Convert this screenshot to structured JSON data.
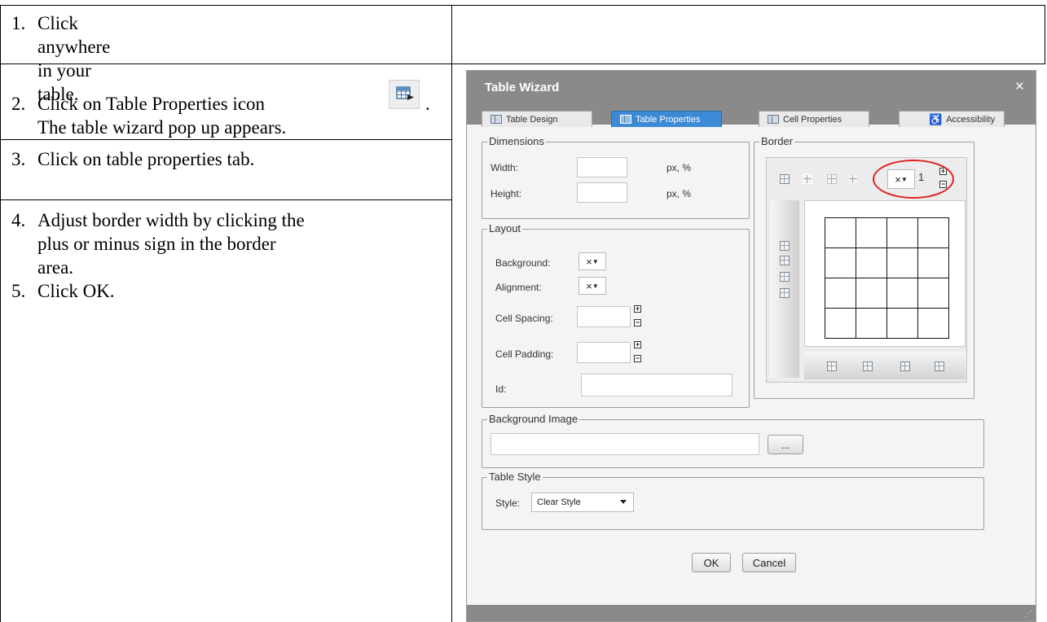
{
  "steps": [
    {
      "num": "1.",
      "lines": [
        "Click anywhere in your table."
      ]
    },
    {
      "num": "2.",
      "lines": [
        "Click on Table Properties icon",
        "The table wizard pop up appears."
      ]
    },
    {
      "num": "3.",
      "lines": [
        "Click on table properties tab."
      ]
    },
    {
      "num": "4.",
      "lines": [
        "Adjust border width by clicking the",
        "plus or minus sign in the border",
        "area."
      ]
    },
    {
      "num": "5.",
      "lines": [
        "Click OK."
      ]
    }
  ],
  "icons": {
    "table_properties": "table-properties-icon",
    "close": "close-icon",
    "plus": "plus-icon",
    "minus": "minus-icon",
    "no_color": "no-color-x-icon",
    "dropdown": "chevron-down-icon",
    "resize": "resize-grip-icon"
  },
  "colors": {
    "title_bar": "#8a8a8a",
    "active_tab": "#3c8ad6",
    "annotation": "#e02020"
  },
  "dialog": {
    "title": "Table Wizard",
    "close": "×",
    "tabs": [
      {
        "label": "Table Design",
        "active": false
      },
      {
        "label": "Table Properties",
        "active": true
      },
      {
        "label": "Cell Properties",
        "active": false
      },
      {
        "label": "Accessibility",
        "active": false
      }
    ],
    "dimensions": {
      "legend": "Dimensions",
      "width_label": "Width:",
      "height_label": "Height:",
      "width_unit": "px, %",
      "height_unit": "px, %",
      "width_value": "",
      "height_value": ""
    },
    "layout": {
      "legend": "Layout",
      "background_label": "Background:",
      "alignment_label": "Alignment:",
      "cell_spacing_label": "Cell Spacing:",
      "cell_padding_label": "Cell Padding:",
      "id_label": "Id:",
      "cell_spacing_value": "",
      "cell_padding_value": "",
      "id_value": ""
    },
    "border": {
      "legend": "Border",
      "width_value": "1",
      "plus": "+",
      "minus": "−"
    },
    "background_image": {
      "legend": "Background Image",
      "value": "",
      "browse_label": "..."
    },
    "table_style": {
      "legend": "Table Style",
      "style_label": "Style:",
      "style_value": "Clear Style"
    },
    "ok_label": "OK",
    "cancel_label": "Cancel"
  }
}
